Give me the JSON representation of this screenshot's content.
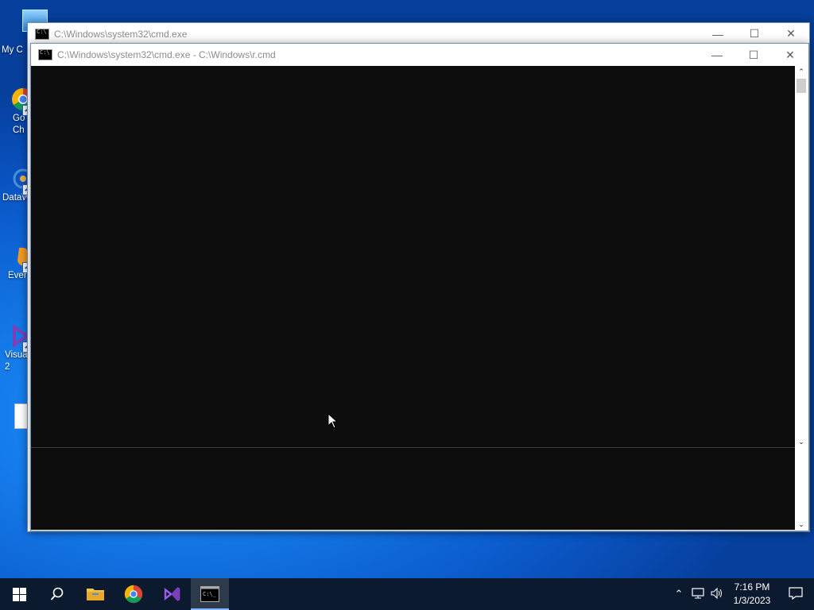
{
  "desktop": {
    "icons": [
      {
        "label": "My C",
        "icon": "computer-icon"
      },
      {
        "label": "Go\nCh",
        "icon": "chrome-icon"
      },
      {
        "label": "DataW",
        "icon": "datawrapper-icon"
      },
      {
        "label": "Ever",
        "icon": "evernote-icon"
      },
      {
        "label": "Visua\n2",
        "icon": "visual-studio-icon"
      },
      {
        "label": "",
        "icon": "document-icon"
      }
    ]
  },
  "windows": {
    "back": {
      "title": "C:\\Windows\\system32\\cmd.exe"
    },
    "front": {
      "title": "C:\\Windows\\system32\\cmd.exe - C:\\Windows\\r.cmd"
    }
  },
  "window_controls": {
    "minimize": "minimize-icon",
    "maximize": "maximize-icon",
    "close": "close-icon"
  },
  "taskbar": {
    "apps": [
      {
        "name": "start",
        "icon": "windows-logo-icon"
      },
      {
        "name": "search",
        "icon": "search-icon"
      },
      {
        "name": "file-explorer",
        "icon": "folder-icon"
      },
      {
        "name": "chrome",
        "icon": "chrome-icon"
      },
      {
        "name": "visual-studio",
        "icon": "visual-studio-icon"
      },
      {
        "name": "command-prompt",
        "icon": "cmd-icon",
        "active": true
      }
    ],
    "tray": {
      "time": "7:16 PM",
      "date": "1/3/2023"
    }
  },
  "colors": {
    "console_bg": "#0c0c0c",
    "taskbar_bg": "#0b1a2e",
    "accent": "#7fb7ff"
  }
}
